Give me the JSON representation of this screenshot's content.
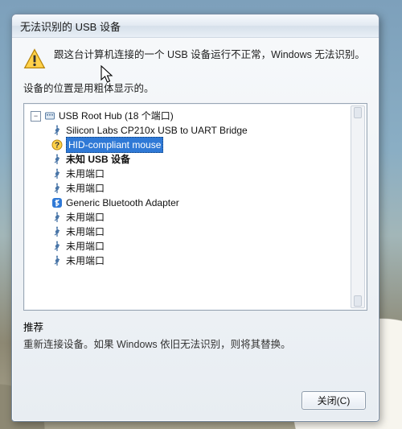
{
  "dialog": {
    "title": "无法识别的 USB 设备",
    "alert_text": "跟这台计算机连接的一个 USB 设备运行不正常，Windows 无法识别。",
    "location_text": "设备的位置是用粗体显示的。",
    "recommend_title": "推荐",
    "recommend_body": "重新连接设备。如果 Windows 依旧无法识别，则将其替换。",
    "close_button": "关闭(C)"
  },
  "tree": {
    "root": "USB Root Hub (18 个端口)",
    "items": [
      {
        "icon": "usb",
        "label": "Silicon Labs CP210x USB to UART Bridge",
        "bold": false,
        "selected": false
      },
      {
        "icon": "q",
        "label": "HID-compliant mouse",
        "bold": false,
        "selected": true
      },
      {
        "icon": "usb",
        "label": "未知 USB 设备",
        "bold": true,
        "selected": false
      },
      {
        "icon": "usb",
        "label": "未用端口",
        "bold": false,
        "selected": false
      },
      {
        "icon": "usb",
        "label": "未用端口",
        "bold": false,
        "selected": false
      },
      {
        "icon": "bt",
        "label": "Generic Bluetooth Adapter",
        "bold": false,
        "selected": false
      },
      {
        "icon": "usb",
        "label": "未用端口",
        "bold": false,
        "selected": false
      },
      {
        "icon": "usb",
        "label": "未用端口",
        "bold": false,
        "selected": false
      },
      {
        "icon": "usb",
        "label": "未用端口",
        "bold": false,
        "selected": false
      },
      {
        "icon": "usb",
        "label": "未用端口",
        "bold": false,
        "selected": false
      }
    ]
  }
}
